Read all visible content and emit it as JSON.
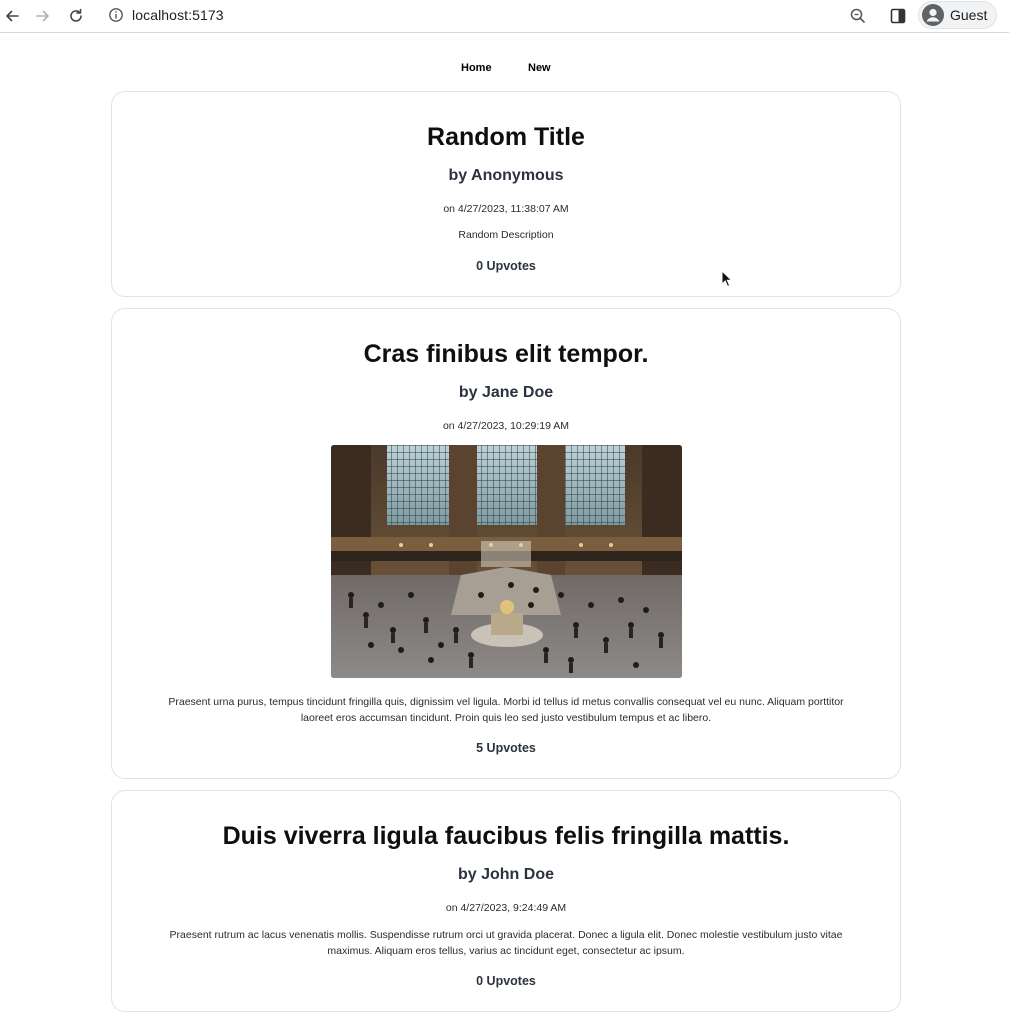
{
  "browser": {
    "url": "localhost:5173",
    "profile_name": "Guest",
    "icons": {
      "back": "arrow-left-icon",
      "forward": "arrow-right-icon",
      "reload": "reload-icon",
      "site_info": "info-icon",
      "zoom": "zoom-icon",
      "side_panel": "side-panel-icon",
      "avatar": "avatar-icon"
    }
  },
  "nav": {
    "home_label": "Home",
    "new_label": "New"
  },
  "posts": [
    {
      "title": "Random Title",
      "author": "by Anonymous",
      "date": "on 4/27/2023, 11:38:07 AM",
      "description": "Random Description",
      "upvotes": "0 Upvotes"
    },
    {
      "title": "Cras finibus elit tempor.",
      "author": "by Jane Doe",
      "date": "on 4/27/2023, 10:29:19 AM",
      "description": "Praesent urna purus, tempus tincidunt fringilla quis, dignissim vel ligula. Morbi id tellus id metus convallis consequat vel eu nunc. Aliquam porttitor laoreet eros accumsan tincidunt. Proin quis leo sed justo vestibulum tempus et ac libero.",
      "upvotes": "5 Upvotes"
    },
    {
      "title": "Duis viverra ligula faucibus felis fringilla mattis.",
      "author": "by John Doe",
      "date": "on 4/27/2023, 9:24:49 AM",
      "description": "Praesent rutrum ac lacus venenatis mollis. Suspendisse rutrum orci ut gravida placerat. Donec a ligula elit. Donec molestie vestibulum justo vitae maximus. Aliquam eros tellus, varius ac tincidunt eget, consectetur ac ipsum.",
      "upvotes": "0 Upvotes"
    }
  ],
  "colors": {
    "card_border": "#e3e3e3",
    "author_text": "#2b3240",
    "title_text": "#0f0f0f"
  }
}
